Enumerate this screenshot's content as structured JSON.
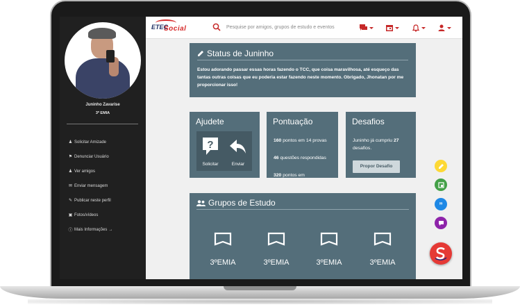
{
  "profile": {
    "name": "Juninho Zavarise",
    "class": "3º EMIA"
  },
  "sidebar": {
    "items": [
      {
        "icon": "user-plus-icon",
        "label": "Solicitar Amizade"
      },
      {
        "icon": "flag-icon",
        "label": "Denunciar Usuário"
      },
      {
        "icon": "users-icon",
        "label": "Ver amigos"
      },
      {
        "icon": "chat-icon",
        "label": "Enviar mensagem"
      },
      {
        "icon": "pencil-icon",
        "label": "Publicar neste perfil"
      },
      {
        "icon": "camera-icon",
        "label": "Fotos/vídeos"
      },
      {
        "icon": "info-icon",
        "label": "Mais Informações"
      }
    ]
  },
  "topbar": {
    "logo_prefix": "ETEC",
    "logo_suffix": "Social",
    "search_placeholder": "Pesquise por amigos, grupos de estudo e eventos",
    "icons": [
      "messages-icon",
      "calendar-icon",
      "bell-icon",
      "account-icon"
    ]
  },
  "status": {
    "title": "Status de Juninho",
    "text": "Estou adorando passar essas horas fazendo o TCC, que coisa maravilhosa, até esqueço das tantas outras coisas que eu poderia estar fazendo neste momento. Obrigado, Jhonatan por me proporcionar isso!"
  },
  "ajude": {
    "title": "Ajudete",
    "request_label": "Solicitar",
    "send_label": "Enviar"
  },
  "pontuacao": {
    "title": "Pontuação",
    "line1_bold": "160",
    "line1_rest": " pontos em 14 provas",
    "line2_bold": "46",
    "line2_rest": " questões respondidas",
    "line3_bold": "320",
    "line3_rest": " pontos em"
  },
  "desafios": {
    "title": "Desafios",
    "text_prefix": "Juninho já cumpriu ",
    "count": "27",
    "text_suffix": " desafios.",
    "button": "Propor Desafio"
  },
  "grupos": {
    "title": "Grupos de Estudo",
    "items": [
      {
        "label": "3ºEMIA"
      },
      {
        "label": "3ºEMIA"
      },
      {
        "label": "3ºEMIA"
      },
      {
        "label": "3ºEMIA"
      }
    ]
  },
  "fabs": {
    "mini": [
      {
        "icon": "pencil-icon",
        "color": "#fdd835"
      },
      {
        "icon": "image-icon",
        "color": "#43a047"
      },
      {
        "icon": "quote-icon",
        "color": "#1e88e5"
      },
      {
        "icon": "chat-icon",
        "color": "#8e24aa"
      }
    ],
    "main_color": "#e53935"
  },
  "colors": {
    "card": "#546e7a",
    "accent": "#c62828",
    "sidebar": "#202020"
  }
}
